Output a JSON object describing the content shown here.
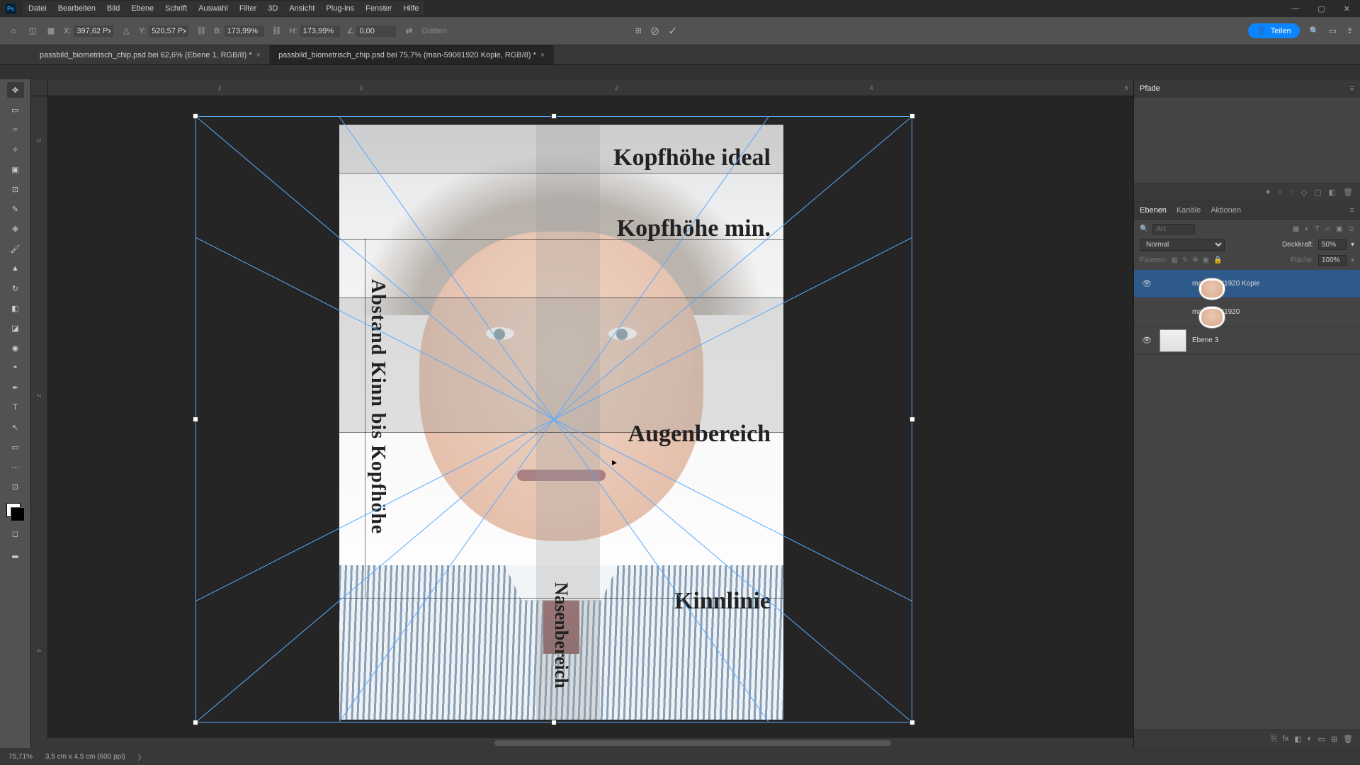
{
  "app": {
    "icon": "Ps"
  },
  "menu": [
    "Datei",
    "Bearbeiten",
    "Bild",
    "Ebene",
    "Schrift",
    "Auswahl",
    "Filter",
    "3D",
    "Ansicht",
    "Plug-ins",
    "Fenster",
    "Hilfe"
  ],
  "options": {
    "x_label": "X:",
    "x": "397,62 Px",
    "y_label": "Y:",
    "y": "520,57 Px",
    "w_label": "B:",
    "w": "173,99%",
    "h_label": "H:",
    "h": "173,99%",
    "a_label": "Δ",
    "a": "0,00",
    "glatten": "Glätten",
    "share": "Teilen"
  },
  "tabs": [
    {
      "title": "passbild_biometrisch_chip.psd bei 62,6% (Ebene 1, RGB/8) *",
      "active": false
    },
    {
      "title": "passbild_biometrisch_chip.psd bei 75,7% (man-59081920 Kopie, RGB/8) *",
      "active": true
    }
  ],
  "ruler_h": [
    "2",
    "0",
    "2",
    "4",
    "6"
  ],
  "ruler_v": [
    "0",
    "2",
    "4"
  ],
  "doc_labels": {
    "kopf_ideal": "Kopfhöhe ideal",
    "kopf_min": "Kopfhöhe min.",
    "augen": "Augenbereich",
    "kinn": "Kinnlinie",
    "abstand": "Abstand Kinn bis Kopfhöhe",
    "nase": "Nasenbereich"
  },
  "panels": {
    "pfade": "Pfade",
    "layer_tabs": [
      "Ebenen",
      "Kanäle",
      "Aktionen"
    ],
    "blend": "Normal",
    "deck_label": "Deckkraft:",
    "deck": "50%",
    "fix_label": "Fixieren:",
    "flache_label": "Fläche:",
    "flache": "100%",
    "search_placeholder": "Art",
    "layers": [
      {
        "name": "man-59081920 Kopie",
        "visible": true,
        "active": true,
        "thumb": "face"
      },
      {
        "name": "man-59081920",
        "visible": false,
        "active": false,
        "thumb": "face"
      },
      {
        "name": "Ebene 3",
        "visible": true,
        "active": false,
        "thumb": "light"
      }
    ]
  },
  "status": {
    "zoom": "75,71%",
    "docinfo": "3,5 cm x 4,5 cm (600 ppi)"
  }
}
